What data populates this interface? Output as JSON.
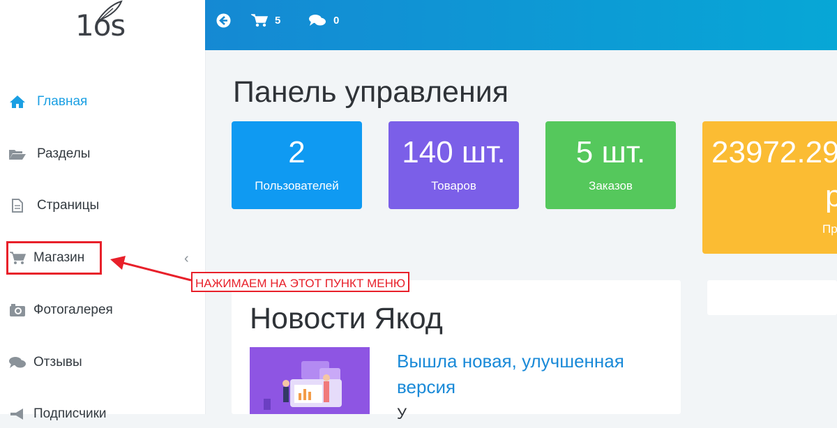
{
  "logo": {
    "text": "1os"
  },
  "sidebar": {
    "items": [
      {
        "label": "Главная",
        "icon": "home-icon"
      },
      {
        "label": "Разделы",
        "icon": "folder-open-icon"
      },
      {
        "label": "Страницы",
        "icon": "file-icon"
      },
      {
        "label": "Магазин",
        "icon": "cart-icon"
      },
      {
        "label": "Фотогалерея",
        "icon": "camera-icon"
      },
      {
        "label": "Отзывы",
        "icon": "comments-icon"
      },
      {
        "label": "Подписчики",
        "icon": "bullhorn-icon"
      }
    ],
    "active_index": 0
  },
  "topbar": {
    "back_icon": "arrow-circle-left-icon",
    "cart_count": "5",
    "messages_count": "0"
  },
  "main": {
    "title": "Панель управления",
    "stats": [
      {
        "value": "2",
        "label": "Пользователей",
        "color": "#0f9af2"
      },
      {
        "value": "140 шт.",
        "label": "Товаров",
        "color": "#7b5fe8"
      },
      {
        "value": "5 шт.",
        "label": "Заказов",
        "color": "#55c85c"
      },
      {
        "value": "23972.29",
        "value2": "р",
        "label": "Пр",
        "color": "#fbbc33"
      }
    ],
    "news": {
      "title": "Новости Якод",
      "item_title": "Вышла новая, улучшенная версия",
      "item_text_start": "У"
    }
  },
  "annotation": {
    "text": "НАЖИМАЕМ НА ЭТОТ ПУНКТ МЕНЮ"
  },
  "colors": {
    "accent": "#1a9fe3",
    "annotation": "#e8202a"
  }
}
